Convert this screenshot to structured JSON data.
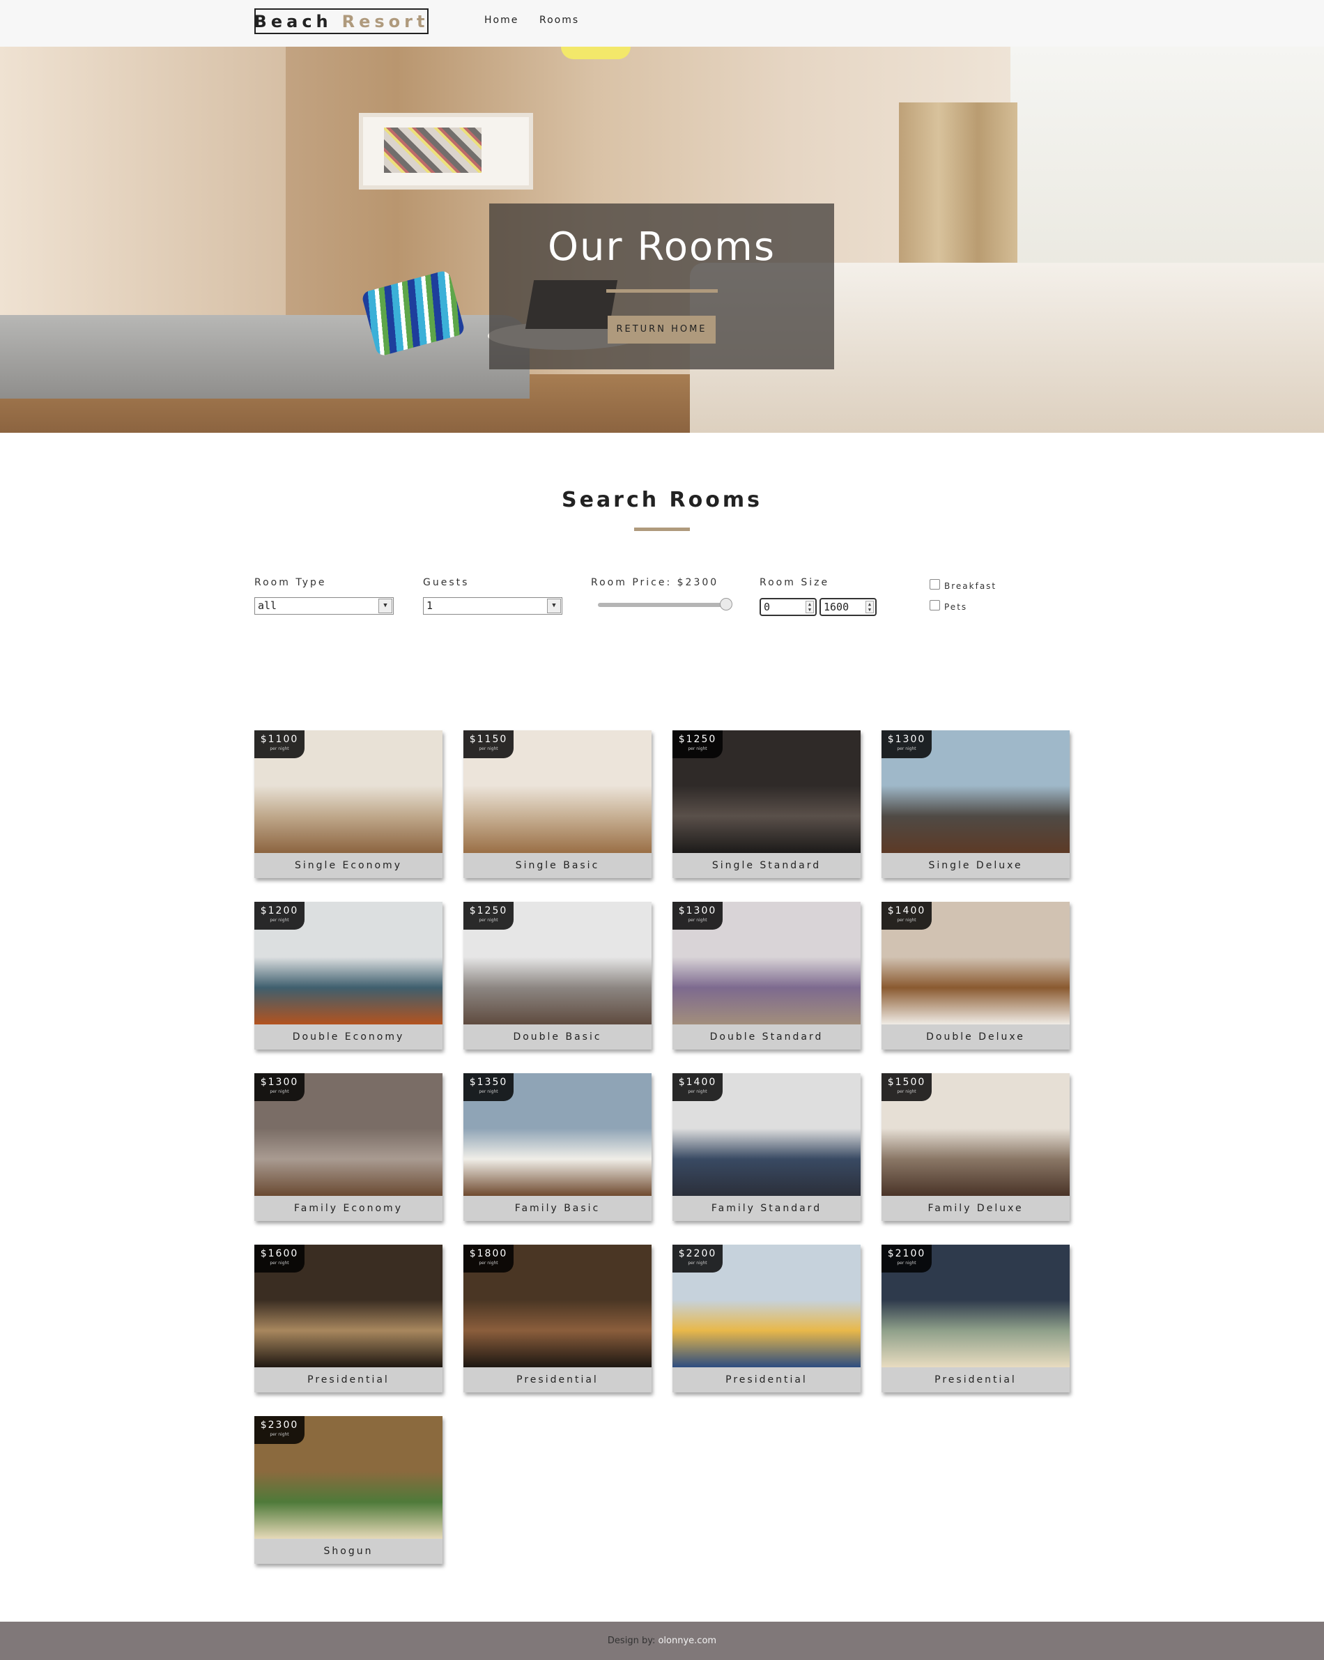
{
  "nav": {
    "logo_word1": "Beach",
    "logo_word2": "Resort",
    "links": [
      "Home",
      "Rooms"
    ]
  },
  "hero": {
    "title": "Our Rooms",
    "button": "RETURN HOME"
  },
  "search": {
    "title": "Search Rooms",
    "room_type_label": "Room Type",
    "room_type_value": "all",
    "guests_label": "Guests",
    "guests_value": "1",
    "price_label": "Room Price: $2300",
    "price_slider_fraction": 1.0,
    "size_label": "Room Size",
    "size_min": "0",
    "size_max": "1600",
    "breakfast_label": "Breakfast",
    "pets_label": "Pets"
  },
  "rooms": [
    {
      "price": "$1100",
      "per": "per night",
      "name": "Single Economy",
      "colors": [
        "#e8e1d6",
        "#bfa88b",
        "#8c6440"
      ]
    },
    {
      "price": "$1150",
      "per": "per night",
      "name": "Single Basic",
      "colors": [
        "#ece4da",
        "#c7b094",
        "#9a6f46"
      ]
    },
    {
      "price": "$1250",
      "per": "per night",
      "name": "Single Standard",
      "colors": [
        "#2f2a28",
        "#5a504a",
        "#1c1a19"
      ]
    },
    {
      "price": "$1300",
      "per": "per night",
      "name": "Single Deluxe",
      "colors": [
        "#9fb8c9",
        "#4f4a45",
        "#5d3a26"
      ]
    },
    {
      "price": "$1200",
      "per": "per night",
      "name": "Double Economy",
      "colors": [
        "#dcdfe0",
        "#3f5f6e",
        "#b3531f"
      ]
    },
    {
      "price": "$1250",
      "per": "per night",
      "name": "Double Basic",
      "colors": [
        "#e6e6e6",
        "#8c8682",
        "#5f4b3f"
      ]
    },
    {
      "price": "$1300",
      "per": "per night",
      "name": "Double Standard",
      "colors": [
        "#d9d4d7",
        "#7d6a8f",
        "#a28e7c"
      ]
    },
    {
      "price": "$1400",
      "per": "per night",
      "name": "Double Deluxe",
      "colors": [
        "#d1c2b2",
        "#8a5a30",
        "#f0ece6"
      ]
    },
    {
      "price": "$1300",
      "per": "per night",
      "name": "Family Economy",
      "colors": [
        "#7a6d66",
        "#a99b91",
        "#6a4a32"
      ]
    },
    {
      "price": "$1350",
      "per": "per night",
      "name": "Family Basic",
      "colors": [
        "#8fa4b6",
        "#f0eee8",
        "#6f4a2f"
      ]
    },
    {
      "price": "$1400",
      "per": "per night",
      "name": "Family Standard",
      "colors": [
        "#dedede",
        "#394a63",
        "#2b2f3a"
      ]
    },
    {
      "price": "$1500",
      "per": "per night",
      "name": "Family Deluxe",
      "colors": [
        "#e6dfd5",
        "#8a7766",
        "#4a3428"
      ]
    },
    {
      "price": "$1600",
      "per": "per night",
      "name": "Presidential",
      "colors": [
        "#3a2d22",
        "#a8875e",
        "#1f1812"
      ]
    },
    {
      "price": "$1800",
      "per": "per night",
      "name": "Presidential",
      "colors": [
        "#4a3624",
        "#8b5e3c",
        "#1d1712"
      ]
    },
    {
      "price": "$2200",
      "per": "per night",
      "name": "Presidential",
      "colors": [
        "#c6d2dc",
        "#e8b84a",
        "#2d4d80"
      ]
    },
    {
      "price": "$2100",
      "per": "per night",
      "name": "Presidential",
      "colors": [
        "#2e3a4c",
        "#8fa08a",
        "#e8dcc0"
      ]
    },
    {
      "price": "$2300",
      "per": "per night",
      "name": "Shogun",
      "colors": [
        "#8b6a3e",
        "#4f7a3a",
        "#e6d9b8"
      ]
    }
  ],
  "footer": {
    "prefix": "Design by:",
    "link": "olonnye.com"
  },
  "colors": {
    "accent": "#af9a7d",
    "navbar_bg": "#f7f7f7",
    "footer_bg": "#807879",
    "card_footer": "#cfcfcf"
  }
}
